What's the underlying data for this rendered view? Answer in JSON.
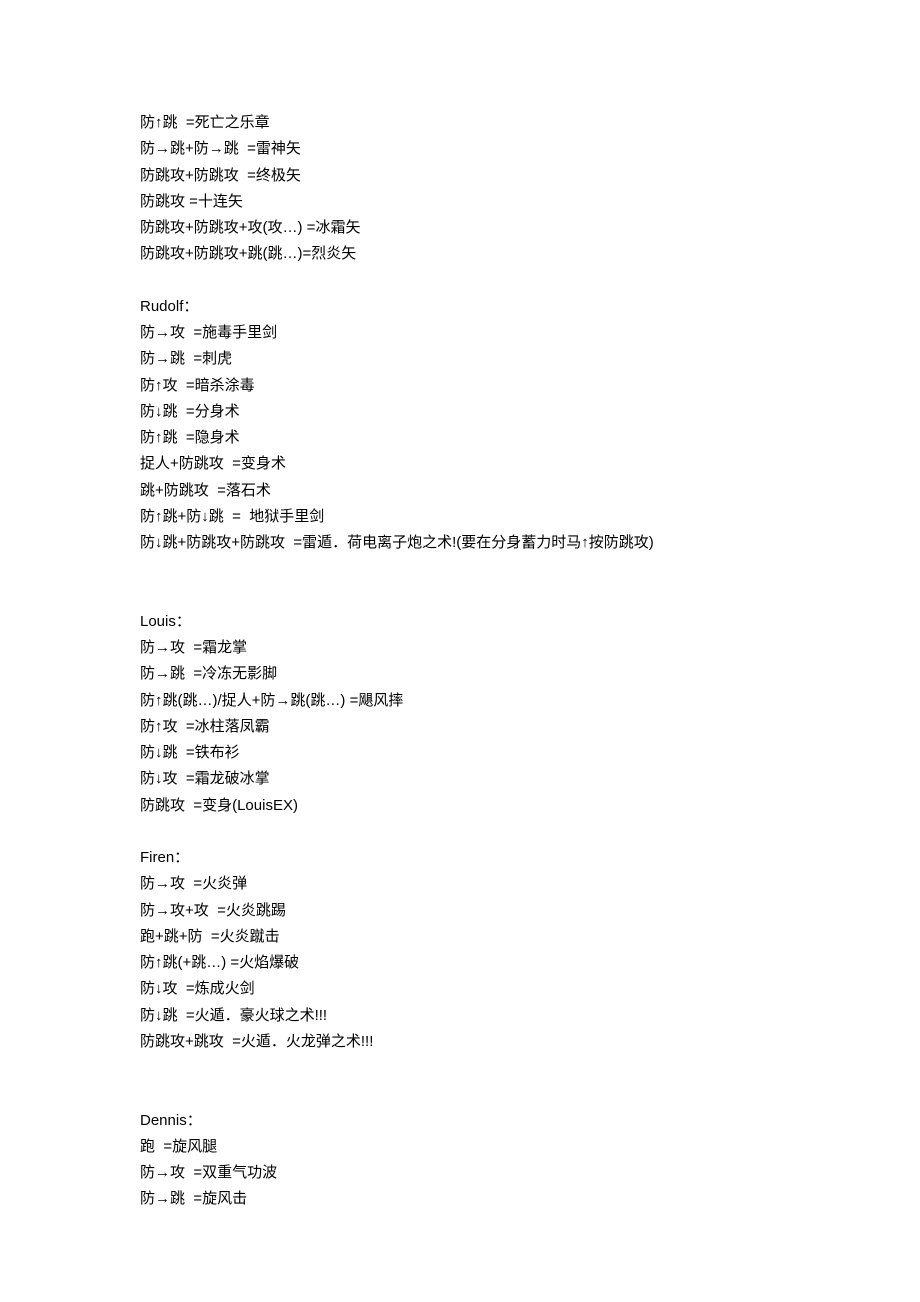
{
  "sections": [
    {
      "title": "",
      "moves": [
        "防↑跳  =死亡之乐章",
        "防→跳+防→跳  =雷神矢",
        "防跳攻+防跳攻  =终极矢",
        "防跳攻 =十连矢",
        "防跳攻+防跳攻+攻(攻…) =冰霜矢",
        "防跳攻+防跳攻+跳(跳…)=烈炎矢"
      ],
      "gap_after": "single"
    },
    {
      "title": "Rudolf：",
      "moves": [
        "防→攻  =施毒手里剑",
        "防→跳  =刺虎",
        "防↑攻  =暗杀涂毒",
        "防↓跳  =分身术",
        "防↑跳  =隐身术",
        "捉人+防跳攻  =变身术",
        "跳+防跳攻  =落石术",
        "防↑跳+防↓跳  =  地狱手里剑",
        "防↓跳+防跳攻+防跳攻  =雷遁．荷电离子炮之术!(要在分身蓄力时马↑按防跳攻)"
      ],
      "gap_after": "double"
    },
    {
      "title": "Louis：",
      "moves": [
        "防→攻  =霜龙掌",
        "防→跳  =冷冻无影脚",
        "防↑跳(跳…)/捉人+防→跳(跳…) =飓风摔",
        "防↑攻  =冰柱落凤霸",
        "防↓跳  =铁布衫",
        "防↓攻  =霜龙破冰掌",
        "防跳攻  =变身(LouisEX)"
      ],
      "gap_after": "single"
    },
    {
      "title": "Firen：",
      "moves": [
        "防→攻  =火炎弹",
        "防→攻+攻  =火炎跳踢",
        "跑+跳+防  =火炎蹴击",
        "防↑跳(+跳…) =火焰爆破",
        "防↓攻  =炼成火剑",
        "防↓跳  =火遁．豪火球之术!!!",
        "防跳攻+跳攻  =火遁．火龙弹之术!!!"
      ],
      "gap_after": "double"
    },
    {
      "title": "Dennis：",
      "moves": [
        "跑  =旋风腿",
        "防→攻  =双重气功波",
        "防→跳  =旋风击"
      ],
      "gap_after": "none"
    }
  ]
}
